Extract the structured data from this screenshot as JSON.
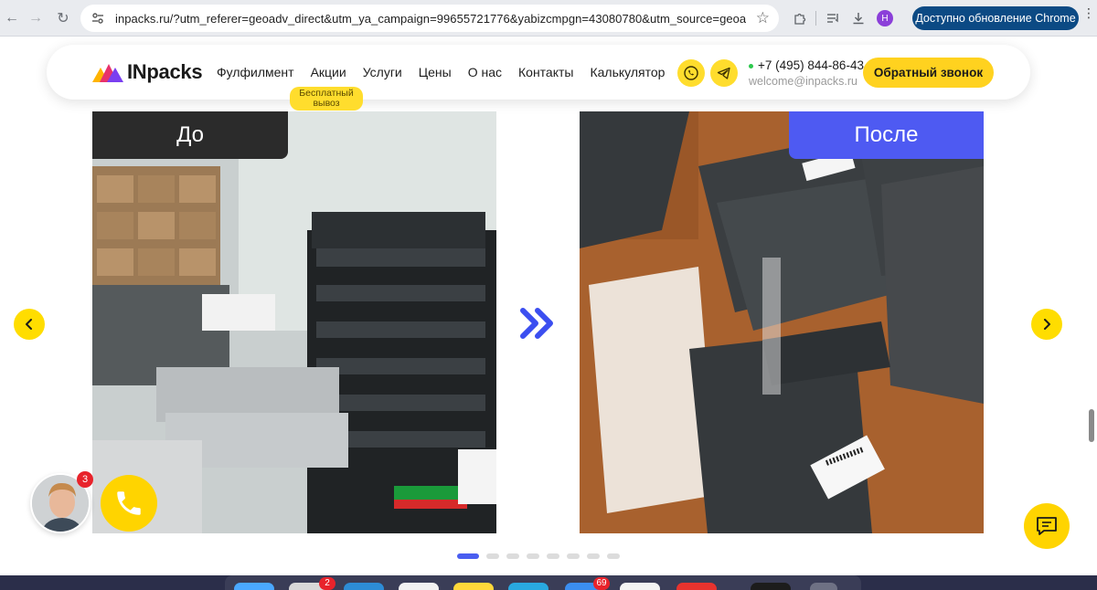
{
  "browser": {
    "url": "inpacks.ru/?utm_referer=geoadv_direct&utm_ya_campaign=99655721776&yabizcmpgn=43080780&utm_source=geoadv...",
    "profile_initial": "Н",
    "update_label": "Доступно обновление Chrome"
  },
  "header": {
    "logo_text": "INpacks",
    "menu": [
      "Фулфилмент",
      "Акции",
      "Услуги",
      "Цены",
      "О нас",
      "Контакты",
      "Калькулятор"
    ],
    "promo_badge": "Бесплатный вывоз",
    "phone": "+7 (495) 844-86-43",
    "email": "welcome@inpacks.ru",
    "callback_label": "Обратный звонок"
  },
  "slider": {
    "before_label": "До",
    "after_label": "После",
    "dots_total": 8,
    "active_dot": 1
  },
  "widgets": {
    "notification_count": "3"
  },
  "dock": {
    "badges": [
      "2",
      "69"
    ]
  },
  "colors": {
    "accent_yellow": "#ffd400",
    "brand_blue": "#4e5af2",
    "dark_tag": "#2b2b2b"
  }
}
